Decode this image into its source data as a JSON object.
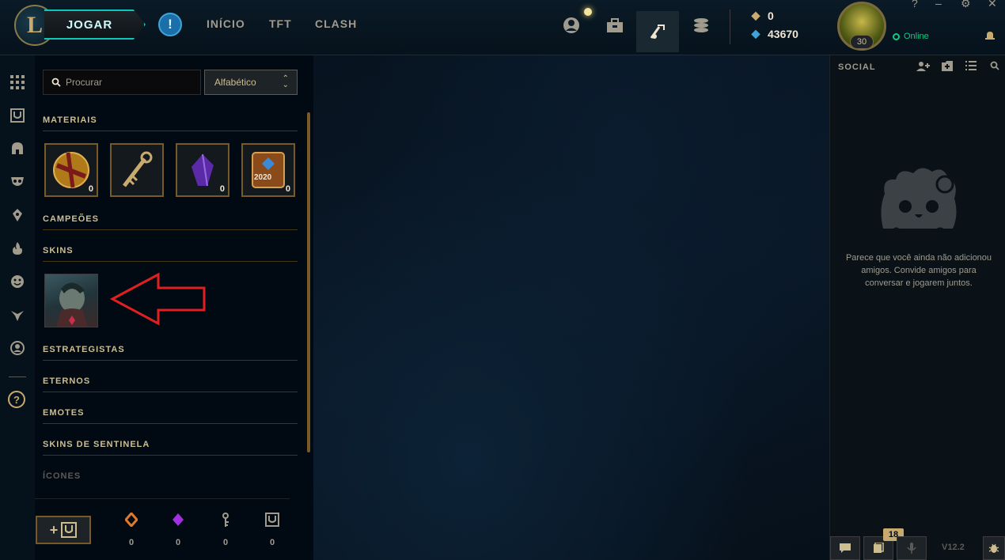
{
  "topbar": {
    "logo_letter": "L",
    "play_label": "JOGAR",
    "alert_glyph": "!",
    "nav": [
      "INÍCIO",
      "TFT",
      "CLASH"
    ],
    "currency": {
      "rp": "0",
      "blue_essence": "43670"
    },
    "level": "30",
    "status": "Online"
  },
  "left_panel": {
    "search_placeholder": "Procurar",
    "sort_label": "Alfabético",
    "sections": {
      "materiais": "MATERIAIS",
      "campeoes": "CAMPEÕES",
      "skins": "SKINS",
      "estrategistas": "ESTRATEGISTAS",
      "eternos": "ETERNOS",
      "emotes": "EMOTES",
      "skins_sentinela": "SKINS DE SENTINELA",
      "icones": "ÍCONES"
    },
    "material_counts": [
      "0",
      "",
      "0",
      "0"
    ],
    "chest_year": "2020",
    "craft_plus": "+",
    "resources": [
      "0",
      "0",
      "0",
      "0"
    ]
  },
  "social": {
    "title": "SOCIAL",
    "empty_message": "Parece que você ainda não adicionou amigos. Convide amigos para conversar e jogarem juntos.",
    "missions_badge": "18",
    "version": "V12.2"
  },
  "colors": {
    "gold": "#c8aa6e",
    "teal": "#0ac8b9",
    "online": "#0acf83",
    "annotation_red": "#e02020"
  }
}
